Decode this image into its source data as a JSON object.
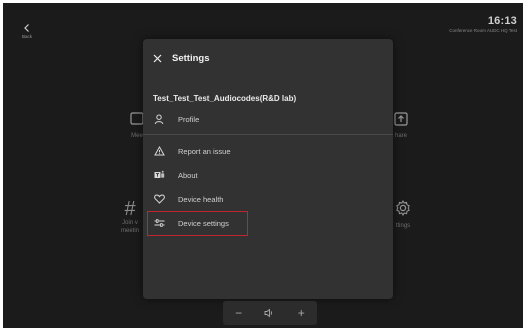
{
  "topbar": {
    "back_label": "Back",
    "time": "16:13",
    "room_name": "Conference Room AUDC HQ Test"
  },
  "home_tiles": [
    {
      "id": "meet",
      "label": "Mee"
    },
    {
      "id": "share",
      "label": "hare"
    },
    {
      "id": "join",
      "label_lines": [
        "Join v",
        "meetin"
      ]
    },
    {
      "id": "settings",
      "label": "ttings"
    }
  ],
  "settings_panel": {
    "title": "Settings",
    "account_name": "Test_Test_Test_Audiocodes(R&D lab)",
    "items": [
      {
        "label": "Profile",
        "icon": "person-icon"
      },
      {
        "label": "Report an issue",
        "icon": "warning-icon"
      },
      {
        "label": "About",
        "icon": "teams-icon"
      },
      {
        "label": "Device health",
        "icon": "heart-icon"
      },
      {
        "label": "Device settings",
        "icon": "sliders-icon",
        "highlighted": true
      }
    ],
    "highlight_color": "#c0262d"
  },
  "volume": {
    "minus": "−",
    "plus": "+",
    "icon": "speaker-icon"
  }
}
